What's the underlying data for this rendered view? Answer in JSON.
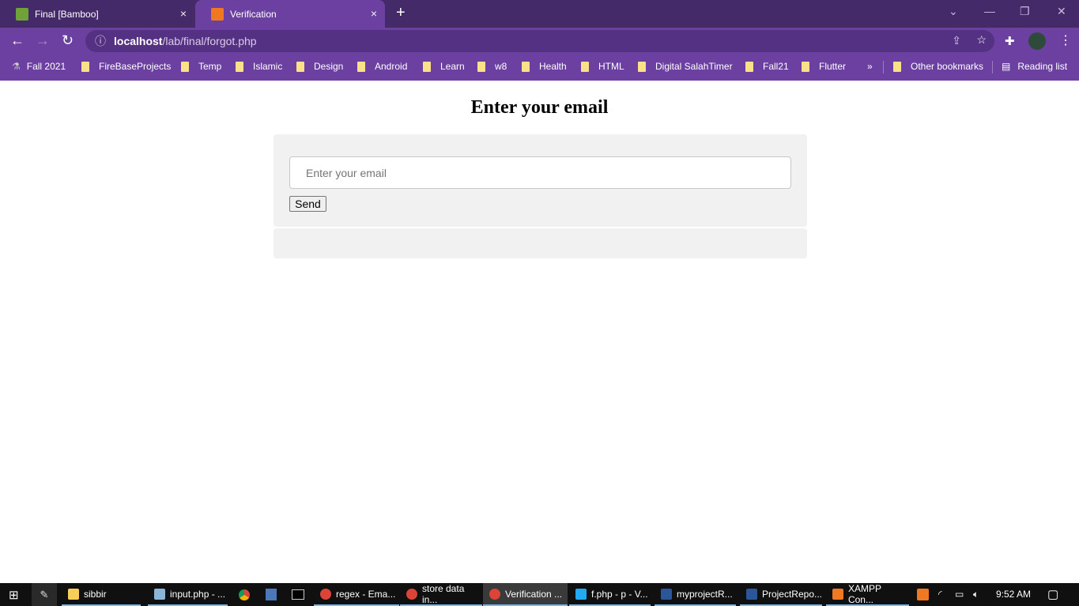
{
  "browser": {
    "tabs": [
      {
        "title": "Final [Bamboo]",
        "active": false
      },
      {
        "title": "Verification",
        "active": true
      }
    ],
    "new_tab": "+",
    "close": "×",
    "url_host": "localhost",
    "url_path": "/lab/final/forgot.php",
    "bookmarks": [
      "Fall 2021",
      "FireBaseProjects",
      "Temp",
      "Islamic",
      "Design",
      "Android",
      "Learn",
      "w8",
      "Health",
      "HTML",
      "Digital SalahTimer",
      "Fall21",
      "Flutter"
    ],
    "more": "»",
    "other_bookmarks": "Other bookmarks",
    "reading_list": "Reading list",
    "accent": "#6b40a0"
  },
  "page": {
    "heading": "Enter your email",
    "email_placeholder": "Enter your email",
    "email_value": "",
    "send_label": "Send"
  },
  "taskbar": {
    "items": [
      "sibbir",
      "input.php - ...",
      "regex - Ema...",
      "store data in...",
      "Verification ...",
      "f.php - p - V...",
      "myprojectR...",
      "ProjectRepo...",
      "XAMPP Con..."
    ],
    "time": "9:52 AM"
  }
}
